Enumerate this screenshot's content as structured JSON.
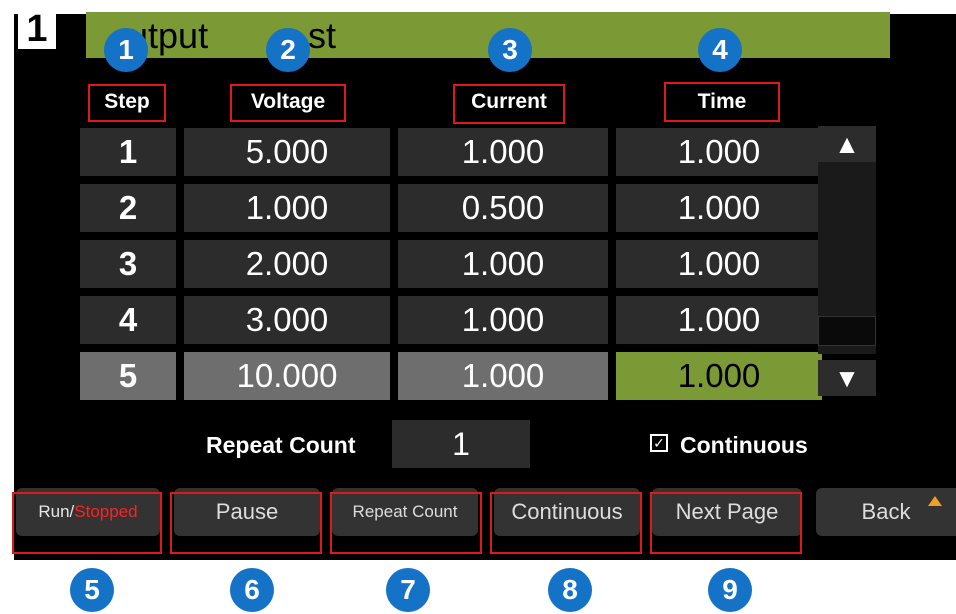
{
  "channel": "1",
  "title": "utput",
  "title_tail": "st",
  "headers": [
    "Step",
    "Voltage",
    "Current",
    "Time"
  ],
  "rows": [
    {
      "step": "1",
      "voltage": "5.000",
      "current": "1.000",
      "time": "1.000"
    },
    {
      "step": "2",
      "voltage": "1.000",
      "current": "0.500",
      "time": "1.000"
    },
    {
      "step": "3",
      "voltage": "2.000",
      "current": "1.000",
      "time": "1.000"
    },
    {
      "step": "4",
      "voltage": "3.000",
      "current": "1.000",
      "time": "1.000"
    },
    {
      "step": "5",
      "voltage": "10.000",
      "current": "1.000",
      "time": "1.000"
    }
  ],
  "scroll": {
    "up": "▲",
    "down": "▼"
  },
  "repeat": {
    "label": "Repeat Count",
    "value": "1"
  },
  "continuous": {
    "checkbox": "☑",
    "label": "Continuous"
  },
  "softkeys": {
    "run_a": "Run/",
    "run_b": "Stopped",
    "pause": "Pause",
    "repeat_count": "Repeat Count",
    "continuous": "Continuous",
    "next_page": "Next Page",
    "back": "Back"
  },
  "badges": [
    "1",
    "2",
    "3",
    "4",
    "5",
    "6",
    "7",
    "8",
    "9"
  ],
  "colors": {
    "title_bar": "#7b9a36",
    "badge": "#1473c6",
    "highlight_box": "#e01818"
  }
}
